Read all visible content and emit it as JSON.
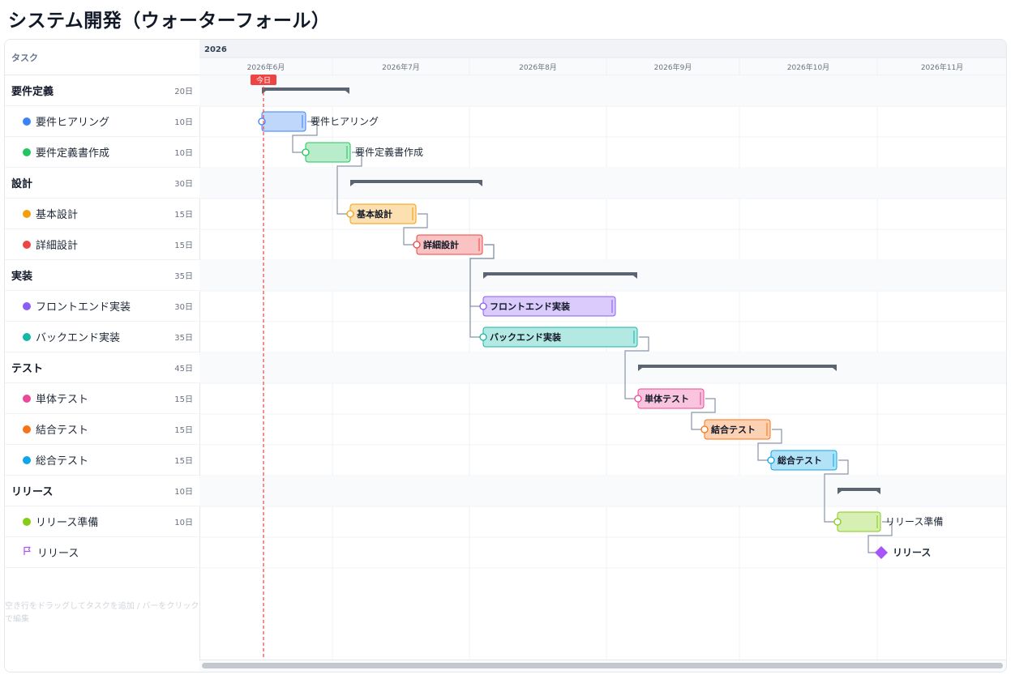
{
  "title": "システム開発（ウォーターフォール）",
  "header": {
    "task_label": "タスク",
    "year": "2026",
    "months": [
      "2026年6月",
      "2026年7月",
      "2026年8月",
      "2026年9月",
      "2026年10月",
      "2026年11月"
    ]
  },
  "today_label": "今日",
  "hint": "空き行をドラッグしてタスクを追加 / バーをクリックで編集",
  "tasks": [
    {
      "id": "g1",
      "type": "group",
      "name": "要件定義",
      "duration": "20日"
    },
    {
      "id": "t1",
      "type": "task",
      "name": "要件ヒアリング",
      "duration": "10日",
      "color": "#3b82f6"
    },
    {
      "id": "t2",
      "type": "task",
      "name": "要件定義書作成",
      "duration": "10日",
      "color": "#22c55e"
    },
    {
      "id": "g2",
      "type": "group",
      "name": "設計",
      "duration": "30日"
    },
    {
      "id": "t3",
      "type": "task",
      "name": "基本設計",
      "duration": "15日",
      "color": "#f59e0b"
    },
    {
      "id": "t4",
      "type": "task",
      "name": "詳細設計",
      "duration": "15日",
      "color": "#ef4444"
    },
    {
      "id": "g3",
      "type": "group",
      "name": "実装",
      "duration": "35日"
    },
    {
      "id": "t5",
      "type": "task",
      "name": "フロントエンド実装",
      "duration": "30日",
      "color": "#8b5cf6"
    },
    {
      "id": "t6",
      "type": "task",
      "name": "バックエンド実装",
      "duration": "35日",
      "color": "#14b8a6"
    },
    {
      "id": "g4",
      "type": "group",
      "name": "テスト",
      "duration": "45日"
    },
    {
      "id": "t7",
      "type": "task",
      "name": "単体テスト",
      "duration": "15日",
      "color": "#ec4899"
    },
    {
      "id": "t8",
      "type": "task",
      "name": "結合テスト",
      "duration": "15日",
      "color": "#f97316"
    },
    {
      "id": "t9",
      "type": "task",
      "name": "総合テスト",
      "duration": "15日",
      "color": "#0ea5e9"
    },
    {
      "id": "g5",
      "type": "group",
      "name": "リリース",
      "duration": "10日"
    },
    {
      "id": "t10",
      "type": "task",
      "name": "リリース準備",
      "duration": "10日",
      "color": "#84cc16"
    },
    {
      "id": "m1",
      "type": "milestone",
      "name": "リリース",
      "duration": "",
      "color": "#a855f7",
      "icon": "flag-icon"
    }
  ],
  "bar_labels": [
    {
      "task": "t1",
      "text": "要件ヒアリング",
      "inside": false
    },
    {
      "task": "t2",
      "text": "要件定義書作成",
      "inside": false
    },
    {
      "task": "t3",
      "text": "基本設計",
      "inside": true
    },
    {
      "task": "t4",
      "text": "詳細設計",
      "inside": true
    },
    {
      "task": "t5",
      "text": "フロントエンド実装",
      "inside": true
    },
    {
      "task": "t6",
      "text": "バックエンド実装",
      "inside": true
    },
    {
      "task": "t7",
      "text": "単体テスト",
      "inside": true
    },
    {
      "task": "t8",
      "text": "結合テスト",
      "inside": true
    },
    {
      "task": "t9",
      "text": "総合テスト",
      "inside": true
    },
    {
      "task": "t10",
      "text": "リリース準備",
      "inside": false
    },
    {
      "task": "m1",
      "text": "リリース",
      "inside": false
    }
  ],
  "colors": {
    "today_line": "#ef4444",
    "group_bar": "#5b6472",
    "connector": "#8a94a6",
    "grid": "#eef0f3",
    "header_bg": "#f1f3f7"
  }
}
